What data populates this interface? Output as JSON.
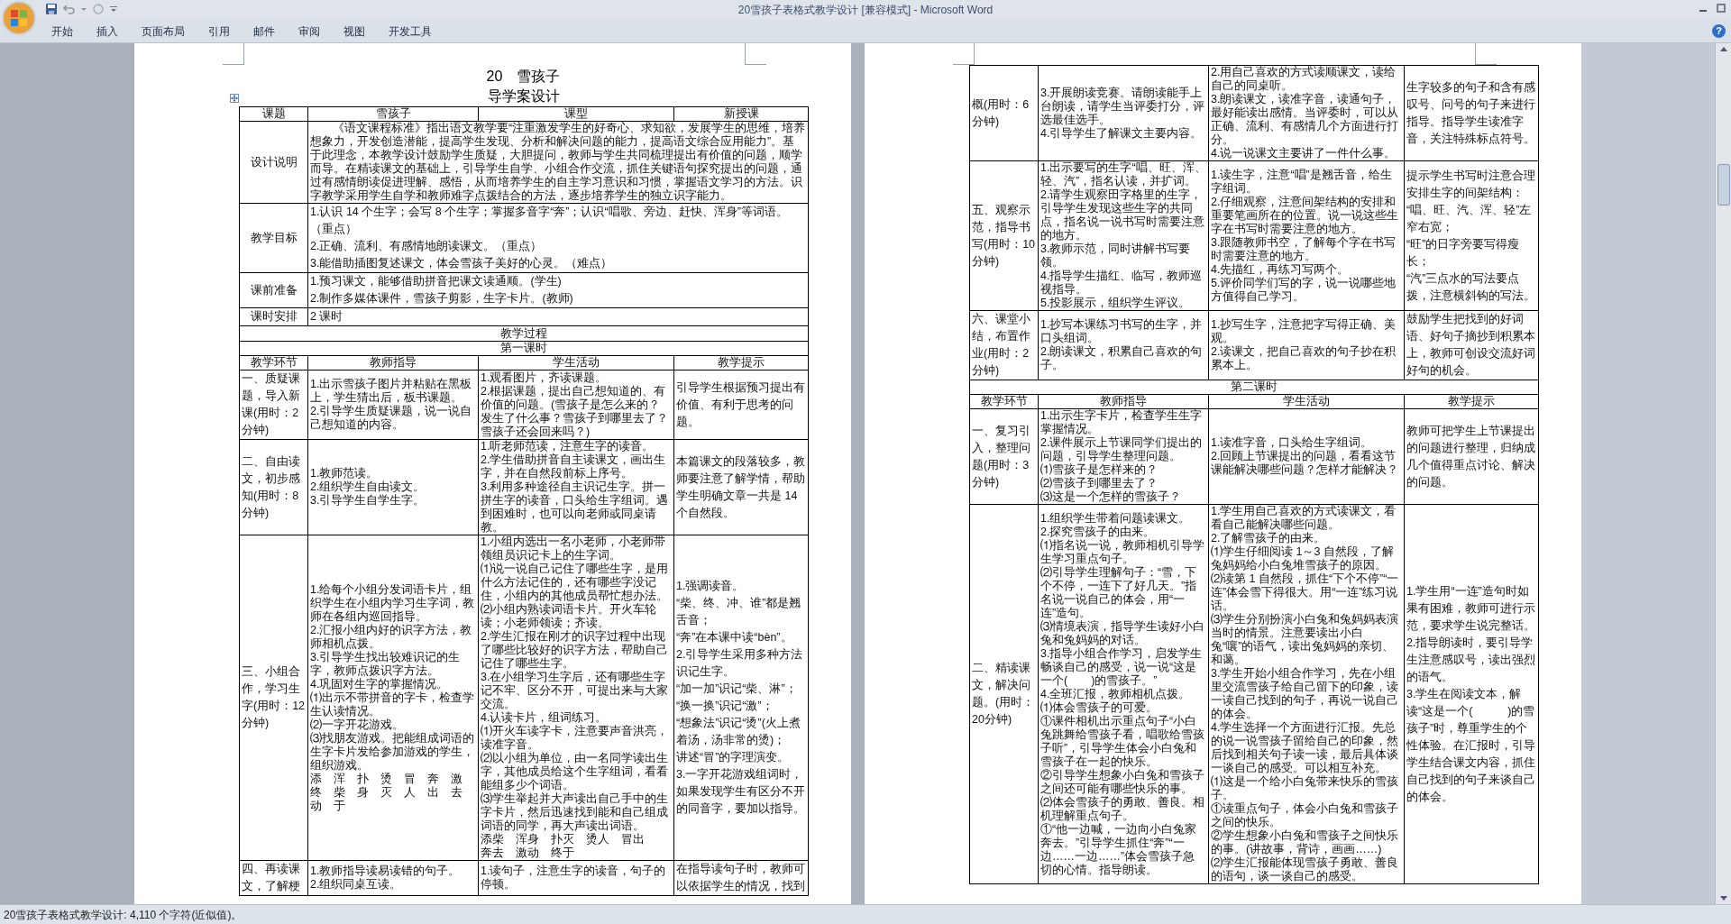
{
  "window": {
    "title": "20雪孩子表格式教学设计 [兼容模式] - Microsoft Word"
  },
  "ribbon_tabs": [
    "开始",
    "插入",
    "页面布局",
    "引用",
    "邮件",
    "审阅",
    "视图",
    "开发工具"
  ],
  "help": "?",
  "left_page": {
    "title": "20　雪孩子",
    "subtitle": "导学案设计",
    "header_row": [
      "课题",
      "雪孩子",
      "课型",
      "新授课"
    ],
    "info_rows": [
      {
        "label": "设计说明",
        "kind": "essay",
        "paragraphs": [
          "《语文课程标准》指出语文教学要“注重激发学生的好奇心、求知欲，发展学生的思维，培养想象力，开发创造潜能，提高学生发现、分析和解决问题的能力，提高语文综合应用能力”。基于此理念，本教学设计鼓励学生质疑，大胆提问，教师与学生共同梳理提出有价值的问题，顺学而导。在精读课文的基础上，引导学生自学、小组合作交流，抓住关键语句探究提出的问题，通过有感情朗读促进理解、感悟，从而培养学生的自主学习意识和习惯，掌握语文学习的方法。识字教学采用学生自学和教师难字点拨结合的方法，逐步培养学生的独立识字能力。"
        ]
      },
      {
        "label": "教学目标",
        "kind": "list",
        "paragraphs": [
          "1.认识 14 个生字；会写 8 个生字；掌握多音字“奔”；认识“唱歌、旁边、赶快、浑身”等词语。（重点）",
          "2.正确、流利、有感情地朗读课文。（重点）",
          "3.能借助插图复述课文，体会雪孩子美好的心灵。（难点）"
        ]
      },
      {
        "label": "课前准备",
        "kind": "list",
        "paragraphs": [
          "1.预习课文，能够借助拼音把课文读通顺。(学生)",
          "2.制作多媒体课件，雪孩子剪影，生字卡片。(教师)"
        ]
      },
      {
        "label": "课时安排",
        "kind": "list",
        "paragraphs": [
          "2 课时"
        ]
      }
    ],
    "process_heading": "教学过程",
    "lesson_heading": "第一课时",
    "columns": [
      "教学环节",
      "教师指导",
      "学生活动",
      "教学提示"
    ],
    "stages": [
      {
        "stage": "一、质疑课题，导入新课(用时：2分钟)",
        "teacher": [
          "1.出示雪孩子图片并粘贴在黑板上，学生猜出后，板书课题。",
          "2.引导学生质疑课题，说一说自己想知道的内容。"
        ],
        "student": [
          "1.观看图片，齐读课题。",
          "2.根据课题，提出自己想知道的、有价值的问题。(雪孩子是怎么来的？发生了什么事？雪孩子到哪里去了？雪孩子还会回来吗？)"
        ],
        "tips": [
          "引导学生根据预习提出有价值、有利于思考的问题。"
        ]
      },
      {
        "stage": "二、自由读文，初步感知(用时：8分钟)",
        "teacher": [
          "1.教师范读。",
          "2.组织学生自由读文。",
          "3.引导学生自学生字。"
        ],
        "student": [
          "1.听老师范读，注意生字的读音。",
          "2.学生借助拼音自主读课文，画出生字，并在自然段前标上序号。",
          "3.利用多种途径自主识记生字。拼一拼生字的读音，口头给生字组词。遇到困难时，也可以向老师或同桌请教。"
        ],
        "tips": [
          "本篇课文的段落较多，教师要注意了解学情，帮助学生明确文章一共是 14 个自然段。"
        ]
      },
      {
        "stage": "三、小组合作，学习生字(用时：12分钟)",
        "teacher": [
          "1.给每个小组分发词语卡片，组织学生在小组内学习生字词，教师在各组内巡回指导。",
          "2.汇报小组内好的识字方法，教师相机点拨。",
          "3.引导学生找出较难识记的生字，教师点拨识字方法。",
          "4.巩固对生字的掌握情况。",
          "⑴出示不带拼音的字卡，检查学生认读情况。",
          "⑵一字开花游戏。",
          "⑶找朋友游戏。把能组成词语的生字卡片发给参加游戏的学生，组织游戏。",
          "添　浑　扑　烫　冒　奔　激",
          "终　柴　身　灭　人　出　去",
          "动　于"
        ],
        "student": [
          "1.小组内选出一名小老师，小老师带领组员识记卡上的生字词。",
          "⑴说一说自己记住了哪些生字，是用什么方法记住的，还有哪些字没记住，小组内的其他成员帮忙想办法。",
          "⑵小组内熟读词语卡片。开火车轮读；小老师领读；齐读。",
          "2.学生汇报在刚才的识字过程中出现了哪些比较好的识字方法，帮助自己记住了哪些生字。",
          "3.在小组学习生字后，还有哪些生字记不牢、区分不开，可提出来与大家交流。",
          "4.认读卡片，组词练习。",
          "⑴开火车读字卡，注意要声音洪亮，读准字音。",
          "⑵以小组为单位，由一名同学读出生字，其他成员给这个生字组词，看看能组多少个词语。",
          "⑶学生举起并大声读出自己手中的生字卡片，然后迅速找到能和自己组成词语的同学，再大声读出词语。",
          "添柴　浑身　扑灭　烫人　冒出",
          "奔去　激动　终于"
        ],
        "tips": [
          "1.强调读音。",
          "“柴、终、冲、谁”都是翘舌音；",
          "“奔”在本课中读“bèn”。",
          "2.引导学生采用多种方法识记生字。",
          "“加一加”识记“柴、淋”；",
          "“换一换”识记“激”；",
          "“想象法”识记“烫”(火上煮着汤，汤非常的烫)；",
          "讲述“冒”的字理演变。",
          "3.一字开花游戏组词时，如果发现学生有区分不开的同音字，要加以指导。"
        ]
      },
      {
        "stage": "四、再读课文，了解梗",
        "teacher": [
          "1.教师指导读易读错的句子。",
          "2.组织同桌互读。"
        ],
        "student": [
          "1.读句子，注意生字的读音，句子的停顿。"
        ],
        "tips": [
          "在指导读句子时，教师可以依据学生的情况，找到"
        ]
      }
    ]
  },
  "right_page": {
    "stages": [
      {
        "stage": "概(用时：6分钟)",
        "teacher": [
          "3.开展朗读竞赛。请朗读能手上台朗读，请学生当评委打分，评选最佳选手。",
          "4.引导学生了解课文主要内容。"
        ],
        "student": [
          "2.用自己喜欢的方式读顺课文，读给自己的同桌听。",
          "3.朗读课文，读准字音，读通句子，最好能读出感情。当评委时，可以从正确、流利、有感情几个方面进行打分。",
          "4.说一说课文主要讲了一件什么事。"
        ],
        "tips": [
          "生字较多的句子和含有感叹号、问号的句子来进行指导。指导学生读准字音，关注特殊标点符号。"
        ]
      },
      {
        "stage": "五、观察示范，指导书写(用时：10分钟)",
        "teacher": [
          "1.出示要写的生字“唱、旺、浑、轻、汽”，指名认读，并扩词。",
          "2.请学生观察田字格里的生字，引导学生发现这些生字的共同点，指名说一说书写时需要注意的地方。",
          "3.教师示范，同时讲解书写要领。",
          "4.指导学生描红、临写，教师巡视指导。",
          "5.投影展示，组织学生评议。"
        ],
        "student": [
          "1.读生字，注意“唱”是翘舌音，给生字组词。",
          "2.仔细观察，注意间架结构的安排和重要笔画所在的位置。说一说这些生字在书写时需要注意的地方。",
          "3.跟随教师书空，了解每个字在书写时需要注意的地方。",
          "4.先描红，再练习写两个。",
          "5.评价同学们写的字，说一说哪些地方值得自己学习。"
        ],
        "tips": [
          "提示学生书写时注意合理安排生字的间架结构：",
          "“唱、旺、汽、浑、轻”左窄右宽；",
          "“旺”的日字旁要写得瘦长；",
          "“汽”三点水的写法要点拨，注意横斜钩的写法。"
        ]
      },
      {
        "stage": "六、课堂小结，布置作业(用时：2分钟)",
        "teacher": [
          "1.抄写本课练习书写的生字，并口头组词。",
          "2.朗读课文，积累自己喜欢的句子。"
        ],
        "student": [
          "1.抄写生字，注意把字写得正确、美观。",
          "2.读课文，把自己喜欢的句子抄在积累本上。"
        ],
        "tips": [
          "鼓励学生把找到的好词语、好句子摘抄到积累本上，教师可创设交流好词好句的机会。"
        ]
      }
    ],
    "lesson_heading": "第二课时",
    "columns": [
      "教学环节",
      "教师指导",
      "学生活动",
      "教学提示"
    ],
    "stages_2": [
      {
        "stage": "一、复习引入，整理问题(用时：3分钟)",
        "teacher": [
          "1.出示生字卡片，检查学生生字掌握情况。",
          "2.课件展示上节课同学们提出的问题，引导学生整理问题。",
          "⑴雪孩子是怎样来的？",
          "⑵雪孩子到哪里去了？",
          "⑶这是一个怎样的雪孩子？"
        ],
        "student": [
          "1.读准字音，口头给生字组词。",
          "2.回顾上节课提出的问题，看看这节课能解决哪些问题？怎样才能解决？"
        ],
        "tips": [
          "教师可把学生上节课提出的问题进行整理，归纳成几个值得重点讨论、解决的问题。"
        ]
      },
      {
        "stage": "二、精读课文，解决问题。(用时：20分钟)",
        "teacher": [
          "1.组织学生带着问题读课文。",
          "2.探究雪孩子的由来。",
          "⑴指名说一说，教师相机引导学生学习重点句子。",
          "⑵引导学生理解句子：“雪，下个不停，一连下了好几天。”指名说一说自己的体会，用“一连”造句。",
          "⑶情境表演，指导学生读好小白兔和兔妈妈的对话。",
          "3.指导小组合作学习，启发学生畅谈自己的感受，说一说“这是一个(　　)的雪孩子。”",
          "4.全班汇报，教师相机点拨。",
          "⑴体会雪孩子的可爱。",
          "①课件相机出示重点句子“小白兔跳舞给雪孩子看，唱歌给雪孩子听”，引导学生体会小白兔和雪孩子在一起的快乐。",
          "②引导学生想象小白兔和雪孩子之间还可能有哪些快乐的事。",
          "⑵体会雪孩子的勇敢、善良。相机理解重点句子。",
          "①“他一边喊，一边向小白兔家奔去。”引导学生抓住“奔”“一边……一边……”体会雪孩子急切的心情。指导朗读。"
        ],
        "student": [
          "1.学生用自己喜欢的方式读课文，看看自己能解决哪些问题。",
          "2.了解雪孩子的由来。",
          "⑴学生仔细阅读 1～3 自然段，了解兔妈妈给小白兔堆雪孩子的原因。",
          "⑵读第 1 自然段，抓住“下个不停”“一连”体会雪下得很大。用“一连”练习说话。",
          "⑶学生分别扮演小白兔和兔妈妈表演当时的情景。注意要读出小白兔“嚷”的语气，读出兔妈妈的亲切、和蔼。",
          "3.学生开始小组合作学习，先在小组里交流雪孩子给自己留下的印象，读一读自己找到的句子，再说一说自己的体会。",
          "4.学生选择一个方面进行汇报。先总的说一说雪孩子留给自己的印象，然后找到相关句子读一读，最后具体谈一谈自己的感受。可以相互补充。",
          "⑴这是一个给小白兔带来快乐的雪孩子。",
          "①读重点句子，体会小白兔和雪孩子之间的快乐。",
          "②学生想象小白兔和雪孩子之间快乐的事。(讲故事，背诗，画画……)",
          "⑵学生汇报能体现雪孩子勇敢、善良的语句，谈一谈自己的感受。"
        ],
        "tips": [
          "1.学生用“一连”造句时如果有困难，教师可进行示范，要求学生说完整话。",
          "2.指导朗读时，要引导学生注意感叹号，读出强烈的语气。",
          "3.学生在阅读文本，解读“这是一个(　　　)的雪孩子”时，尊重学生的个性体验。在汇报时，引导学生结合课文内容，抓住自己找到的句子来谈自己的体会。"
        ]
      }
    ]
  },
  "status_bar": {
    "text": "20雪孩子表格式教学设计: 4,110 个字符(近似值)。"
  }
}
